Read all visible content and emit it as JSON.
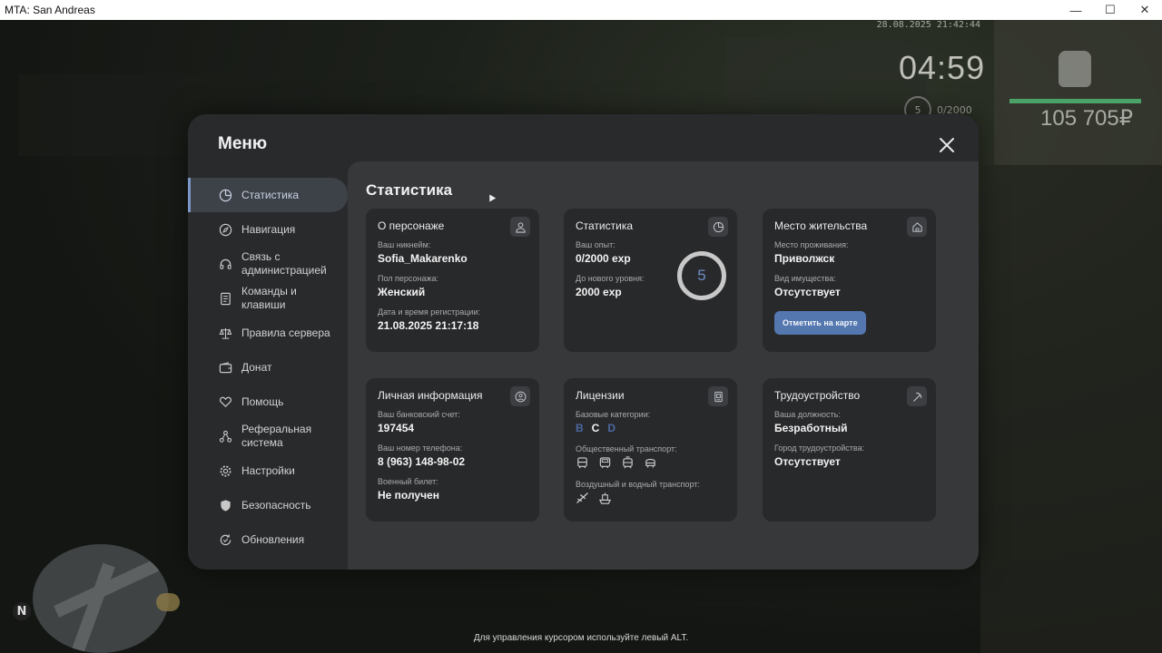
{
  "window": {
    "title": "MTA: San Andreas",
    "minimize": "—",
    "maximize": "☐",
    "close": "✕"
  },
  "hud": {
    "datetime": "28.08.2025 21:42:44",
    "time": "04:59",
    "level": "5",
    "exp": "0/2000",
    "money": "105 705₽"
  },
  "hint": "Для управления курсором используйте левый ALT.",
  "minimap": {
    "north": "N"
  },
  "menu": {
    "title": "Меню",
    "nav": [
      {
        "label": "Статистика",
        "icon": "pie-chart-icon",
        "active": true
      },
      {
        "label": "Навигация",
        "icon": "compass-icon"
      },
      {
        "label": "Связь с администрацией",
        "icon": "headset-icon"
      },
      {
        "label": "Команды и клавиши",
        "icon": "document-icon"
      },
      {
        "label": "Правила сервера",
        "icon": "scales-icon"
      },
      {
        "label": "Донат",
        "icon": "wallet-icon"
      },
      {
        "label": "Помощь",
        "icon": "heart-hand-icon"
      },
      {
        "label": "Реферальная система",
        "icon": "referral-icon"
      },
      {
        "label": "Настройки",
        "icon": "gear-icon"
      },
      {
        "label": "Безопасность",
        "icon": "shield-icon"
      },
      {
        "label": "Обновления",
        "icon": "refresh-icon"
      }
    ]
  },
  "stats": {
    "title": "Статистика",
    "character": {
      "title": "О персонаже",
      "nick_label": "Ваш никнейм:",
      "nick": "Sofia_Makarenko",
      "gender_label": "Пол персонажа:",
      "gender": "Женский",
      "reg_label": "Дата и время регистрации:",
      "reg": "21.08.2025 21:17:18"
    },
    "statistics": {
      "title": "Статистика",
      "exp_label": "Ваш опыт:",
      "exp": "0/2000 exp",
      "next_label": "До нового уровня:",
      "next": "2000 exp",
      "level": "5"
    },
    "residence": {
      "title": "Место жительства",
      "place_label": "Место проживания:",
      "place": "Приволжск",
      "property_label": "Вид имущества:",
      "property": "Отсутствует",
      "button": "Отметить на карте"
    },
    "personal": {
      "title": "Личная информация",
      "bank_label": "Ваш банковский счет:",
      "bank": "197454",
      "phone_label": "Ваш номер телефона:",
      "phone": "8 (963) 148-98-02",
      "military_label": "Военный билет:",
      "military": "Не получен"
    },
    "licenses": {
      "title": "Лицензии",
      "basic_label": "Базовые категории:",
      "categories": [
        "B",
        "C",
        "D"
      ],
      "public_label": "Общественный транспорт:",
      "air_label": "Воздушный и водный транспорт:"
    },
    "employment": {
      "title": "Трудоустройство",
      "position_label": "Ваша должность:",
      "position": "Безработный",
      "city_label": "Город трудоустройства:",
      "city": "Отсутствует"
    }
  }
}
